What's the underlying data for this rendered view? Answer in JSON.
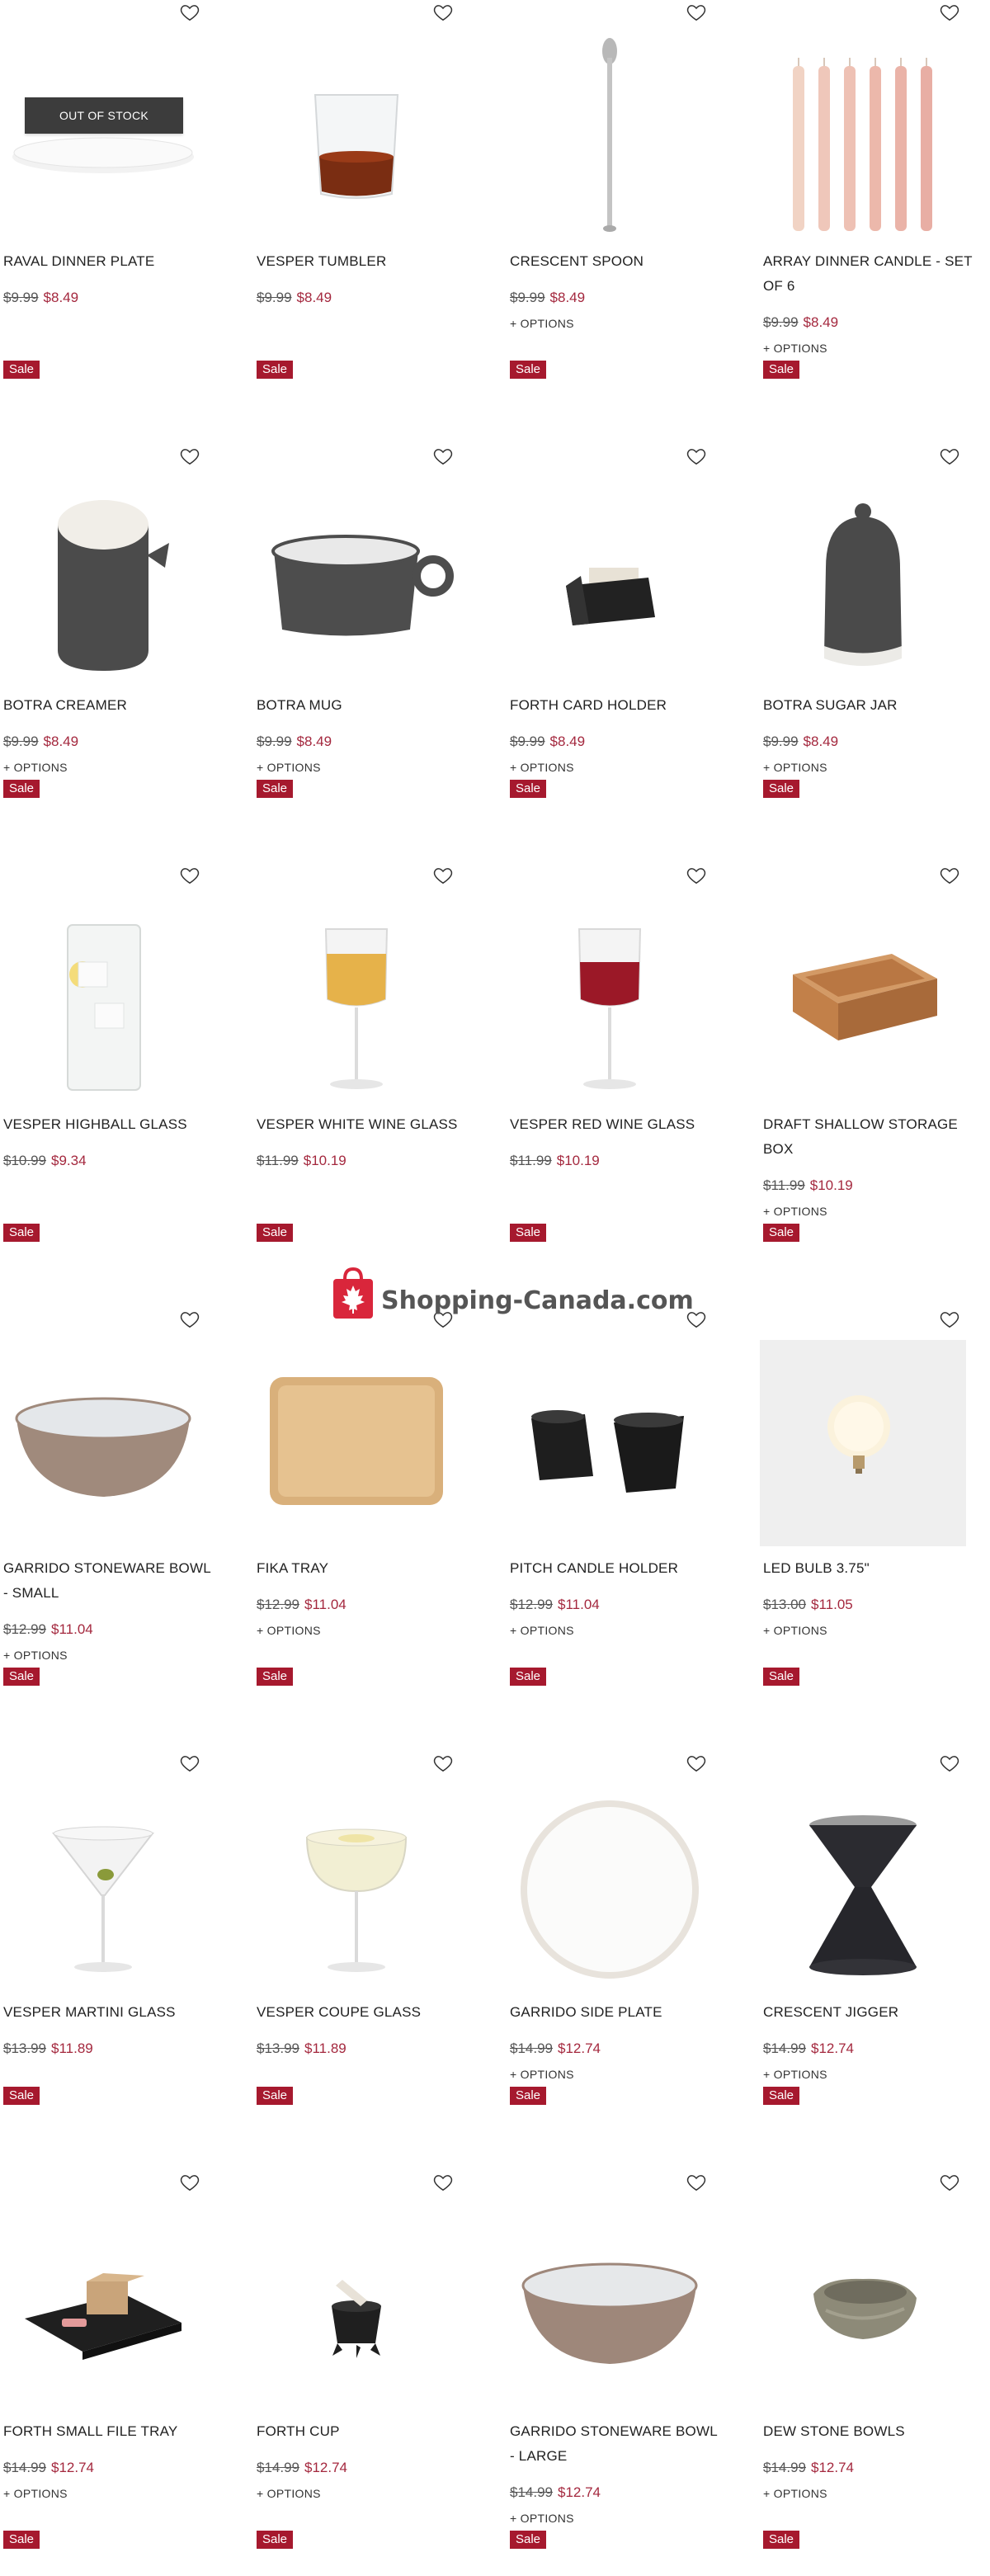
{
  "colors": {
    "sale_badge": "#a6192e",
    "sale_price": "#a4283e",
    "watermark_red": "#d9263b",
    "watermark_text": "#555555"
  },
  "labels": {
    "sale": "Sale",
    "options": "+ OPTIONS",
    "out_of_stock": "OUT OF STOCK",
    "favorite_icon": "heart-outline-icon"
  },
  "watermark": {
    "text": "Shopping-Canada.com",
    "icon": "shopping-bag-maple-leaf-icon"
  },
  "products": [
    {
      "name": "RAVAL DINNER PLATE",
      "was": "$9.99",
      "now": "$8.49",
      "options": false,
      "out_of_stock": true,
      "image": "white-dinner-plate"
    },
    {
      "name": "VESPER TUMBLER",
      "was": "$9.99",
      "now": "$8.49",
      "options": false,
      "image": "glass-tumbler-with-amber-drink"
    },
    {
      "name": "CRESCENT SPOON",
      "was": "$9.99",
      "now": "$8.49",
      "options": true,
      "image": "long-bar-spoon"
    },
    {
      "name": "ARRAY DINNER CANDLE - SET OF 6",
      "was": "$9.99",
      "now": "$8.49",
      "options": true,
      "image": "six-pink-taper-candles"
    },
    {
      "name": "BOTRA CREAMER",
      "was": "$9.99",
      "now": "$8.49",
      "options": true,
      "image": "grey-ceramic-creamer"
    },
    {
      "name": "BOTRA MUG",
      "was": "$9.99",
      "now": "$8.49",
      "options": true,
      "image": "grey-ceramic-mug"
    },
    {
      "name": "FORTH CARD HOLDER",
      "was": "$9.99",
      "now": "$8.49",
      "options": true,
      "image": "black-card-holder"
    },
    {
      "name": "BOTRA SUGAR JAR",
      "was": "$9.99",
      "now": "$8.49",
      "options": true,
      "image": "grey-sugar-jar"
    },
    {
      "name": "VESPER HIGHBALL GLASS",
      "was": "$10.99",
      "now": "$9.34",
      "options": false,
      "image": "highball-glass-with-lemon"
    },
    {
      "name": "VESPER WHITE WINE GLASS",
      "was": "$11.99",
      "now": "$10.19",
      "options": false,
      "image": "white-wine-glass"
    },
    {
      "name": "VESPER RED WINE GLASS",
      "was": "$11.99",
      "now": "$10.19",
      "options": false,
      "image": "red-wine-glass"
    },
    {
      "name": "DRAFT SHALLOW STORAGE BOX",
      "was": "$11.99",
      "now": "$10.19",
      "options": true,
      "image": "wooden-storage-box"
    },
    {
      "name": "GARRIDO STONEWARE BOWL - SMALL",
      "was": "$12.99",
      "now": "$11.04",
      "options": true,
      "image": "stoneware-bowl"
    },
    {
      "name": "FIKA TRAY",
      "was": "$12.99",
      "now": "$11.04",
      "options": true,
      "image": "wooden-tray"
    },
    {
      "name": "PITCH CANDLE HOLDER",
      "was": "$12.99",
      "now": "$11.04",
      "options": true,
      "image": "black-candle-holders"
    },
    {
      "name": "LED BULB 3.75\"",
      "was": "$13.00",
      "now": "$11.05",
      "options": true,
      "image": "globe-led-bulb"
    },
    {
      "name": "VESPER MARTINI GLASS",
      "was": "$13.99",
      "now": "$11.89",
      "options": false,
      "image": "martini-glass-with-olive"
    },
    {
      "name": "VESPER COUPE GLASS",
      "was": "$13.99",
      "now": "$11.89",
      "options": false,
      "image": "coupe-glass"
    },
    {
      "name": "GARRIDO SIDE PLATE",
      "was": "$14.99",
      "now": "$12.74",
      "options": true,
      "image": "white-side-plate"
    },
    {
      "name": "CRESCENT JIGGER",
      "was": "$14.99",
      "now": "$12.74",
      "options": true,
      "image": "black-jigger"
    },
    {
      "name": "FORTH SMALL FILE TRAY",
      "was": "$14.99",
      "now": "$12.74",
      "options": true,
      "image": "black-file-tray"
    },
    {
      "name": "FORTH CUP",
      "was": "$14.99",
      "now": "$12.74",
      "options": true,
      "image": "black-footed-cup"
    },
    {
      "name": "GARRIDO STONEWARE BOWL - LARGE",
      "was": "$14.99",
      "now": "$12.74",
      "options": true,
      "image": "large-stoneware-bowl"
    },
    {
      "name": "DEW STONE BOWLS",
      "was": "$14.99",
      "now": "$12.74",
      "options": true,
      "image": "stone-bowl"
    }
  ]
}
